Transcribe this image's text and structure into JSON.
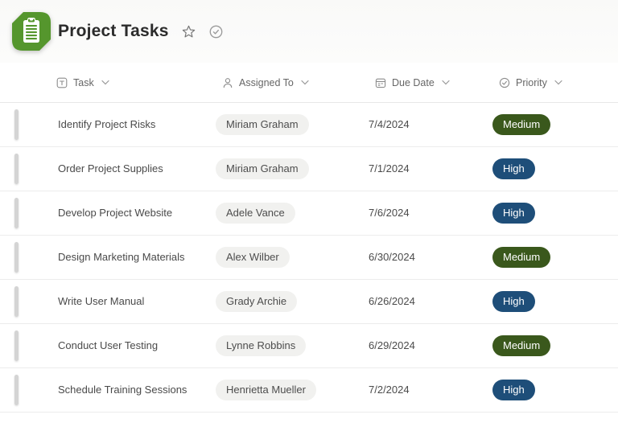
{
  "header": {
    "title": "Project Tasks",
    "app_icon": "clipboard-list-icon",
    "favorite_icon": "star-icon",
    "status_icon": "check-circle-icon"
  },
  "columns": [
    {
      "label": "Task",
      "icon": "text-column-icon"
    },
    {
      "label": "Assigned To",
      "icon": "person-icon"
    },
    {
      "label": "Due Date",
      "icon": "calendar-icon"
    },
    {
      "label": "Priority",
      "icon": "check-circle-icon"
    }
  ],
  "rows": [
    {
      "task": "Identify Project Risks",
      "assigned_to": "Miriam Graham",
      "due_date": "7/4/2024",
      "priority": "Medium"
    },
    {
      "task": "Order Project Supplies",
      "assigned_to": "Miriam Graham",
      "due_date": "7/1/2024",
      "priority": "High"
    },
    {
      "task": "Develop Project Website",
      "assigned_to": "Adele Vance",
      "due_date": "7/6/2024",
      "priority": "High"
    },
    {
      "task": "Design Marketing Materials",
      "assigned_to": "Alex Wilber",
      "due_date": "6/30/2024",
      "priority": "Medium"
    },
    {
      "task": "Write User Manual",
      "assigned_to": "Grady Archie",
      "due_date": "6/26/2024",
      "priority": "High"
    },
    {
      "task": "Conduct User Testing",
      "assigned_to": "Lynne Robbins",
      "due_date": "6/29/2024",
      "priority": "Medium"
    },
    {
      "task": "Schedule Training Sessions",
      "assigned_to": "Henrietta Mueller",
      "due_date": "7/2/2024",
      "priority": "High"
    }
  ],
  "colors": {
    "app_green": "#55962d",
    "priority_medium": "#3a581c",
    "priority_high": "#1e4e79",
    "person_pill_bg": "#f1f1ef"
  }
}
